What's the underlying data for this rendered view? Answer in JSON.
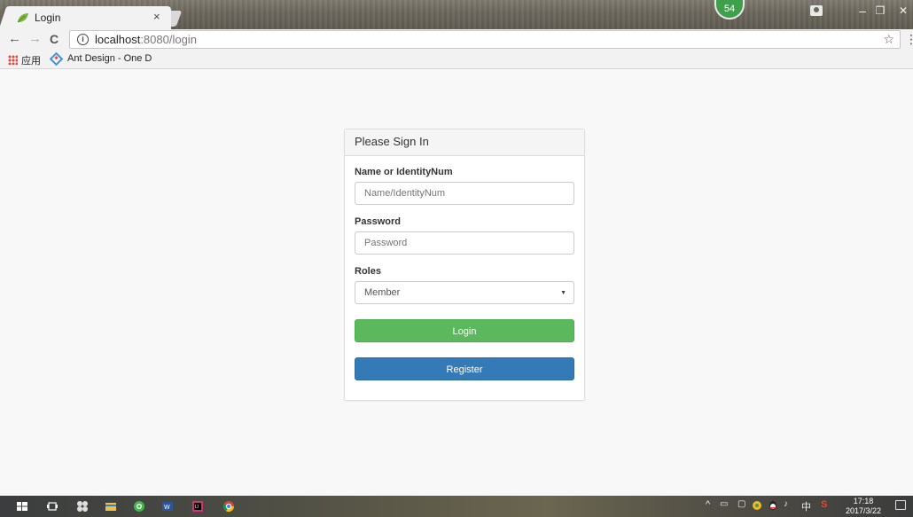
{
  "browser": {
    "tab_title": "Login",
    "tab_close": "×",
    "notification_count": "54",
    "url_host": "localhost",
    "url_rest": ":8080/login",
    "minimize": "–",
    "restore": "❐",
    "close": "✕"
  },
  "bookmarks": {
    "apps_label": "应用",
    "items": [
      {
        "label": "Ant Design - One D"
      }
    ]
  },
  "login": {
    "heading": "Please Sign In",
    "name_label": "Name or IdentityNum",
    "name_placeholder": "Name/IdentityNum",
    "password_label": "Password",
    "password_placeholder": "Password",
    "roles_label": "Roles",
    "roles_selected": "Member",
    "login_button": "Login",
    "register_button": "Register"
  },
  "taskbar": {
    "ime": "中",
    "time": "17:18",
    "date": "2017/3/22"
  },
  "colors": {
    "login_button": "#5cb85c",
    "register_button": "#337ab7",
    "badge": "#3ea04a"
  }
}
